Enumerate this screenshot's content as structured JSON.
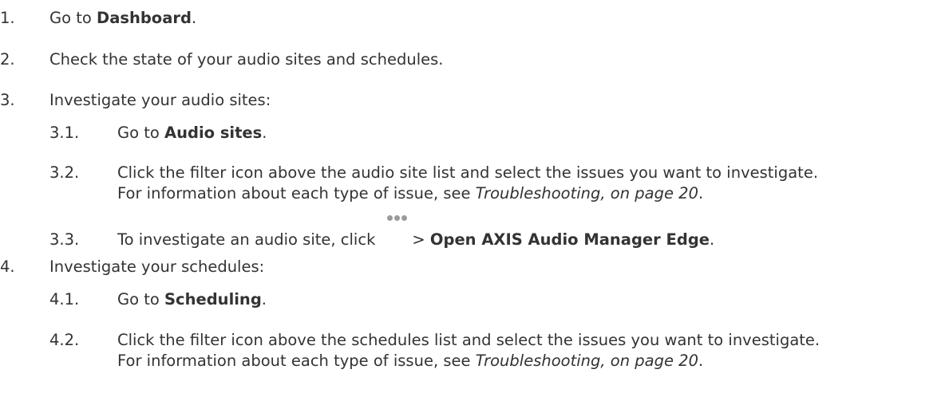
{
  "steps": {
    "s1": {
      "num": "1.",
      "pre": "Go to ",
      "bold": "Dashboard",
      "post": "."
    },
    "s2": {
      "num": "2.",
      "text": "Check the state of your audio sites and schedules."
    },
    "s3": {
      "num": "3.",
      "text": "Investigate your audio sites:"
    },
    "s3_1": {
      "num": "3.1.",
      "pre": "Go to ",
      "bold": "Audio sites",
      "post": "."
    },
    "s3_2": {
      "num": "3.2.",
      "line1": "Click the filter icon above the audio site list and select the issues you want to investigate.",
      "line2_pre": "For information about each type of issue, see ",
      "link": "Troubleshooting, on page 20",
      "line2_post": "."
    },
    "s3_3": {
      "num": "3.3.",
      "pre": "To investigate an audio site, click",
      "mid": "> ",
      "bold": "Open AXIS Audio Manager Edge",
      "post": ".",
      "icon": "more-dots-icon"
    },
    "s4": {
      "num": "4.",
      "text": "Investigate your schedules:"
    },
    "s4_1": {
      "num": "4.1.",
      "pre": "Go to ",
      "bold": "Scheduling",
      "post": "."
    },
    "s4_2": {
      "num": "4.2.",
      "line1": "Click the filter icon above the schedules list and select the issues you want to investigate.",
      "line2_pre": "For information about each type of issue, see ",
      "link": "Troubleshooting, on page 20",
      "line2_post": "."
    }
  },
  "colors": {
    "text": "#333333",
    "icon": "#9a9a9a"
  }
}
